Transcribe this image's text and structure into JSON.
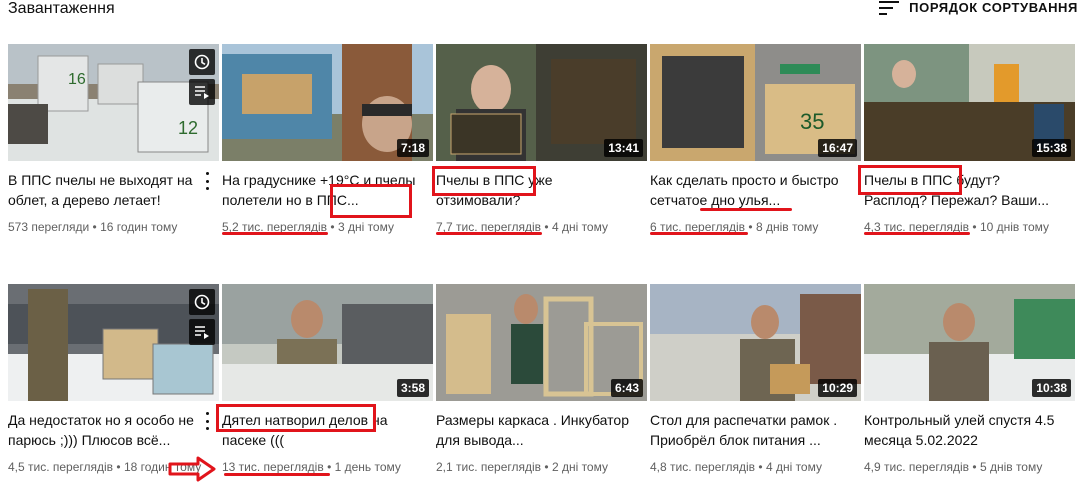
{
  "header": {
    "title": "Завантаження",
    "sort_label": "ПОРЯДОК СОРТУВАННЯ"
  },
  "videos": [
    {
      "title": "В ППС пчелы не выходят на облет, а дерево летает!",
      "views": "573 перегляди",
      "age": "16 годин тому",
      "duration": "",
      "icon": "beehive-thumbnail"
    },
    {
      "title": "На градуснике +19°С и пчелы полетели но в ППС...",
      "views": "5,2 тис. переглядів",
      "age": "3 дні тому",
      "duration": "7:18",
      "icon": "beehive-thumbnail"
    },
    {
      "title": "Пчелы в ППС уже отзимовали?",
      "views": "7,7 тис. переглядів",
      "age": "4 дні тому",
      "duration": "13:41",
      "icon": "bees-frame-thumbnail"
    },
    {
      "title": "Как сделать просто и быстро сетчатое дно улья...",
      "views": "6 тис. переглядів",
      "age": "8 днів тому",
      "duration": "16:47",
      "icon": "mesh-bottom-thumbnail"
    },
    {
      "title": "Пчелы в ППС будут? Расплод? Пережал? Ваши...",
      "views": "4,3 тис. переглядів",
      "age": "10 днів тому",
      "duration": "15:38",
      "icon": "bees-frame-thumbnail"
    },
    {
      "title": "Да недостаток но я особо не парюсь ;))) Плюсов всё...",
      "views": "4,5 тис. переглядів",
      "age": "18 годин тому",
      "duration": "",
      "icon": "beehive-thumbnail"
    },
    {
      "title": "Дятел натворил делов на пасеке (((",
      "views": "13 тис. переглядів",
      "age": "1 день тому",
      "duration": "3:58",
      "icon": "man-outdoor-thumbnail"
    },
    {
      "title": "Размеры каркаса . Инкубатор для вывода...",
      "views": "2,1 тис. переглядів",
      "age": "2 дні тому",
      "duration": "6:43",
      "icon": "frame-workshop-thumbnail"
    },
    {
      "title": "Стол для распечатки рамок . Приобрёл блок питания ...",
      "views": "4,8 тис. переглядів",
      "age": "4 дні тому",
      "duration": "10:29",
      "icon": "man-outdoor-thumbnail"
    },
    {
      "title": "Контрольный улей спустя 4.5 месяца 5.02.2022",
      "views": "4,9 тис. переглядів",
      "age": "5 днів тому",
      "duration": "10:38",
      "icon": "man-outdoor-thumbnail"
    }
  ],
  "colors": {
    "annotation_red": "#e1141b",
    "meta_gray": "#606060",
    "text": "#0f0f0f"
  }
}
